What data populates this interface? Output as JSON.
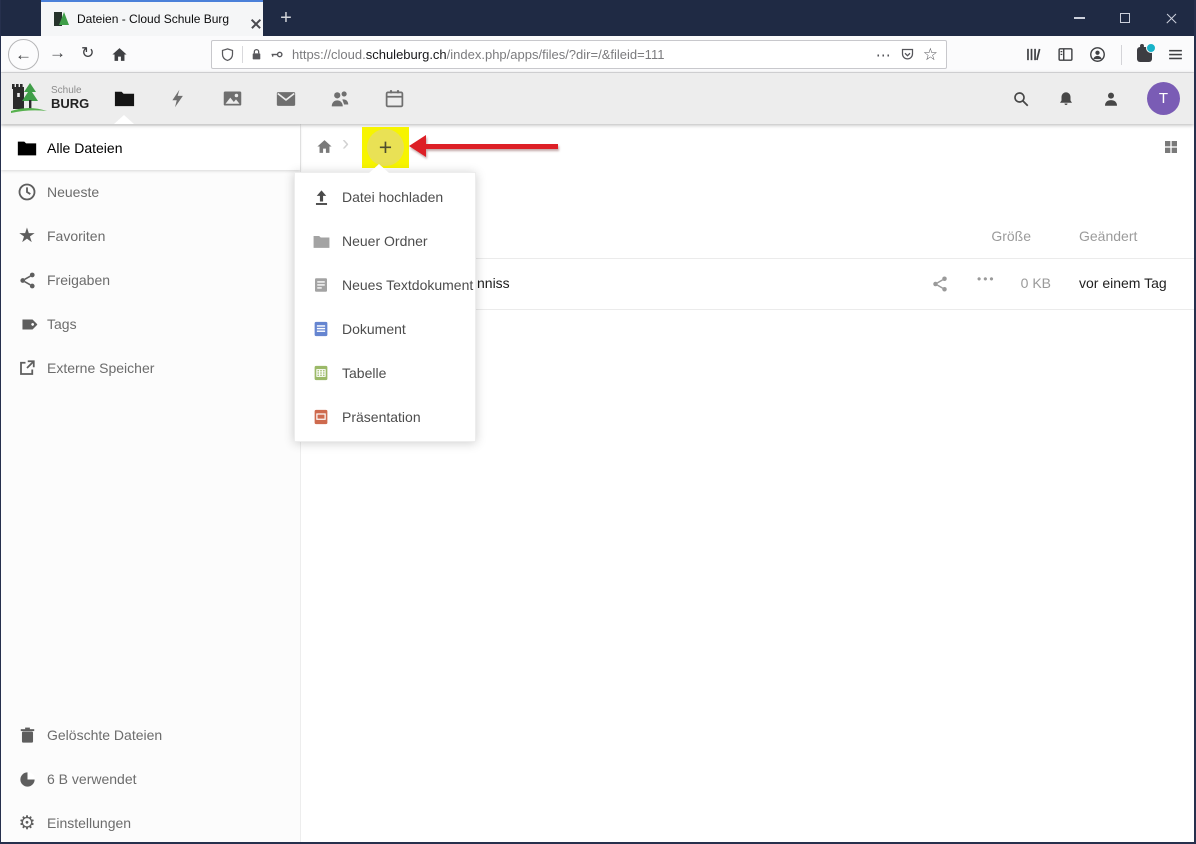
{
  "browser": {
    "tab_title": "Dateien - Cloud Schule Burg",
    "url_prefix": "https://cloud.",
    "url_domain": "schuleburg.ch",
    "url_path": "/index.php/apps/files/?dir=/&fileid=111"
  },
  "icons": {
    "back": "←",
    "forward": "→",
    "reload": "↻",
    "plus": "+",
    "dots": "⋯",
    "star_outline": "☆",
    "star_filled": "★",
    "gear": "⚙",
    "chevron": "›",
    "row_dots": "•••"
  },
  "app_header": {
    "logo_top": "Schule",
    "logo_bottom": "BURG",
    "avatar_initial": "T"
  },
  "sidebar": {
    "items": [
      {
        "label": "Alle Dateien",
        "icon": "folder",
        "active": true
      },
      {
        "label": "Neueste",
        "icon": "clock",
        "active": false
      },
      {
        "label": "Favoriten",
        "icon": "star",
        "active": false
      },
      {
        "label": "Freigaben",
        "icon": "share",
        "active": false
      },
      {
        "label": "Tags",
        "icon": "tag",
        "active": false
      },
      {
        "label": "Externe Speicher",
        "icon": "external-link",
        "active": false
      }
    ],
    "footer": [
      {
        "label": "Gelöschte Dateien",
        "icon": "trash"
      },
      {
        "label": "6 B verwendet",
        "icon": "quota-pie"
      },
      {
        "label": "Einstellungen",
        "icon": "gear"
      }
    ]
  },
  "files": {
    "col_size": "Größe",
    "col_modified": "Geändert",
    "row": {
      "name_fragment": "nniss",
      "size": "0 KB",
      "modified": "vor einem Tag"
    }
  },
  "new_menu": {
    "items": [
      {
        "label": "Datei hochladen",
        "icon": "upload"
      },
      {
        "label": "Neuer Ordner",
        "icon": "folder"
      },
      {
        "label": "Neues Textdokument",
        "icon": "text-file"
      },
      {
        "label": "Dokument",
        "icon": "document"
      },
      {
        "label": "Tabelle",
        "icon": "spreadsheet"
      },
      {
        "label": "Präsentation",
        "icon": "presentation"
      }
    ]
  },
  "colors": {
    "titlebar_navy": "#1f2a44",
    "tab_accent_blue": "#4a80d9",
    "highlight_yellow": "#f7f400",
    "arrow_red": "#dd1f26",
    "avatar_purple": "#7a5cb5",
    "document_blue": "#6585d0",
    "spreadsheet_green": "#9bb968",
    "presentation_orange": "#ce6a4e"
  }
}
